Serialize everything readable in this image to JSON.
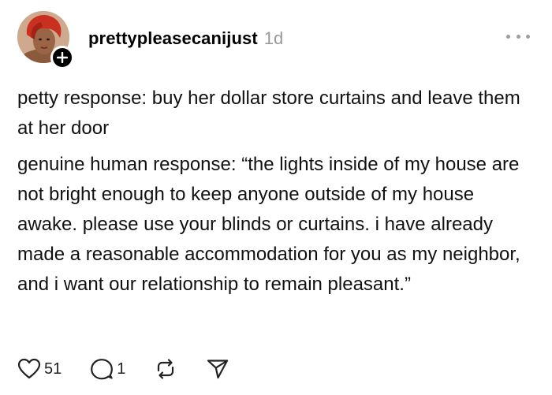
{
  "post": {
    "username": "prettypleasecanijust",
    "timestamp": "1d",
    "paragraphs": [
      "petty response: buy her dollar store curtains and leave them at her door",
      "genuine human response: “the lights inside of my house are not bright enough to keep anyone outside of my house awake. please use your blinds or curtains. i have already made a reasonable accommodation for you as my neighbor, and i want our relationship to remain pleasant.”"
    ]
  },
  "actions": {
    "likes": "51",
    "comments": "1"
  },
  "icons": {
    "avatar": "user-avatar",
    "follow": "plus-icon",
    "more": "more-dots-icon",
    "like": "heart-icon",
    "comment": "comment-icon",
    "repost": "repost-icon",
    "share": "send-icon"
  },
  "colors": {
    "text": "#000000",
    "muted": "#999999",
    "avatar_scarf": "#c9301f"
  }
}
